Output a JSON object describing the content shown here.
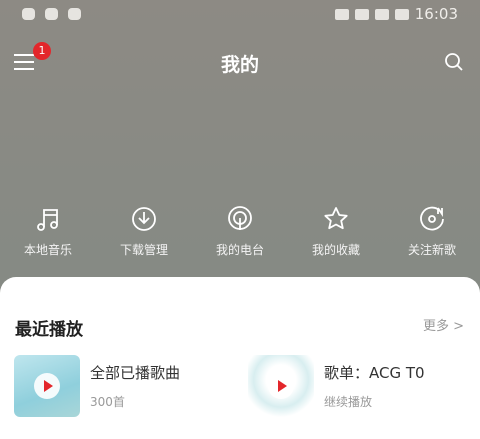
{
  "status": {
    "time": "16:03"
  },
  "nav": {
    "title": "我的",
    "badge": "1"
  },
  "quick": [
    {
      "label": "本地音乐",
      "icon": "music-note-icon"
    },
    {
      "label": "下载管理",
      "icon": "download-icon"
    },
    {
      "label": "我的电台",
      "icon": "radio-icon"
    },
    {
      "label": "我的收藏",
      "icon": "star-icon"
    },
    {
      "label": "关注新歌",
      "icon": "new-song-icon"
    }
  ],
  "recent": {
    "title": "最近播放",
    "more": "更多 >",
    "items": [
      {
        "title": "全部已播歌曲",
        "sub": "300首"
      },
      {
        "title": "歌单：ACG T0",
        "sub": "继续播放"
      }
    ]
  },
  "colors": {
    "accent": "#e3262b"
  }
}
